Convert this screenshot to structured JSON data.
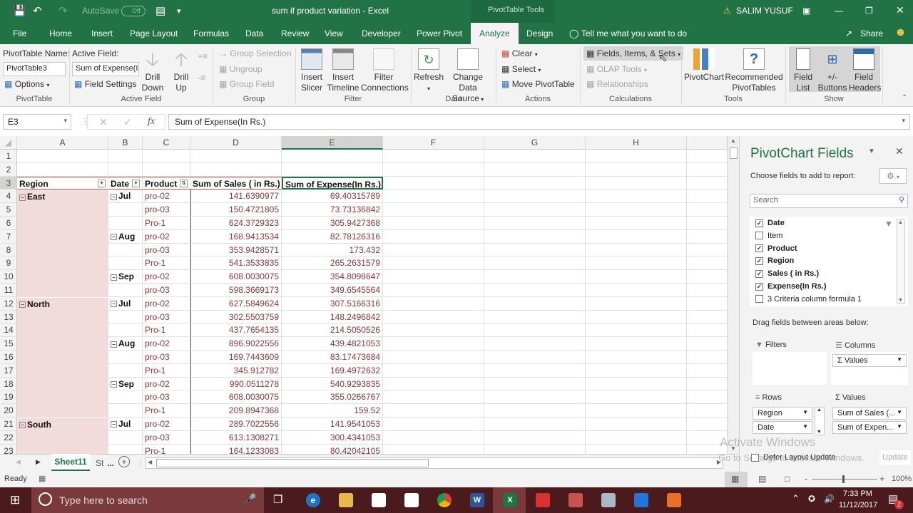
{
  "titlebar": {
    "autosave_label": "AutoSave",
    "autosave_state": "Off",
    "doc_title": "sum if product variation  -  Excel",
    "context_tab": "PivotTable Tools",
    "user": "SALIM YUSUF"
  },
  "tabs": {
    "items": [
      "File",
      "Home",
      "Insert",
      "Page Layout",
      "Formulas",
      "Data",
      "Review",
      "View",
      "Developer",
      "Power Pivot",
      "Analyze",
      "Design"
    ],
    "active": "Analyze",
    "tell_me": "Tell me what you want to do",
    "share": "Share"
  },
  "ribbon": {
    "pivottable": {
      "name_label": "PivotTable Name:",
      "name_value": "PivotTable3",
      "options": "Options",
      "group": "PivotTable"
    },
    "active_field": {
      "label": "Active Field:",
      "value": "Sum of Expense(In Rs.)",
      "field_settings": "Field Settings",
      "drill_down_1": "Drill",
      "drill_down_2": "Down",
      "drill_up_1": "Drill",
      "drill_up_2": "Up",
      "group": "Active Field"
    },
    "group": {
      "group_selection": "Group Selection",
      "ungroup": "Ungroup",
      "group_field": "Group Field",
      "group": "Group"
    },
    "filter": {
      "insert_slicer_1": "Insert",
      "insert_slicer_2": "Slicer",
      "insert_timeline_1": "Insert",
      "insert_timeline_2": "Timeline",
      "filter_conn_1": "Filter",
      "filter_conn_2": "Connections",
      "group": "Filter"
    },
    "data": {
      "refresh": "Refresh",
      "change_1": "Change Data",
      "change_2": "Source",
      "group": "Data"
    },
    "actions": {
      "clear": "Clear",
      "select": "Select",
      "move": "Move PivotTable",
      "group": "Actions"
    },
    "calculations": {
      "fields_items_sets": "Fields, Items, & Sets",
      "olap": "OLAP Tools",
      "relationships": "Relationships",
      "group": "Calculations"
    },
    "tools": {
      "pivotchart": "PivotChart",
      "recommended_1": "Recommended",
      "recommended_2": "PivotTables",
      "group": "Tools"
    },
    "show": {
      "field_list_1": "Field",
      "field_list_2": "List",
      "buttons_1": "+/-",
      "buttons_2": "Buttons",
      "headers_1": "Field",
      "headers_2": "Headers",
      "group": "Show"
    }
  },
  "formula_bar": {
    "name_box": "E3",
    "formula": "Sum of Expense(In Rs.)"
  },
  "grid": {
    "columns": [
      "A",
      "B",
      "C",
      "D",
      "E",
      "F",
      "G",
      "H"
    ],
    "selected_column": "E",
    "row_numbers": [
      "1",
      "2",
      "3",
      "4",
      "5",
      "6",
      "7",
      "8",
      "9",
      "10",
      "11",
      "12",
      "13",
      "14",
      "15",
      "16",
      "17",
      "18",
      "19",
      "20",
      "21",
      "22",
      "23"
    ],
    "headers": [
      "Region",
      "Date",
      "Product",
      "Sum of Sales ( in Rs.)",
      "Sum of Expense(In Rs.)"
    ],
    "rows": [
      {
        "region": "East",
        "date": "Jul",
        "product": "pro-02",
        "sales": "141.6390977",
        "expense": "69.40315789"
      },
      {
        "region": "",
        "date": "",
        "product": "pro-03",
        "sales": "150.4721805",
        "expense": "73.73136842"
      },
      {
        "region": "",
        "date": "",
        "product": "Pro-1",
        "sales": "624.3729323",
        "expense": "305.9427368"
      },
      {
        "region": "",
        "date": "Aug",
        "product": "pro-02",
        "sales": "168.9413534",
        "expense": "82.78126316"
      },
      {
        "region": "",
        "date": "",
        "product": "pro-03",
        "sales": "353.9428571",
        "expense": "173.432"
      },
      {
        "region": "",
        "date": "",
        "product": "Pro-1",
        "sales": "541.3533835",
        "expense": "265.2631579"
      },
      {
        "region": "",
        "date": "Sep",
        "product": "pro-02",
        "sales": "608.0030075",
        "expense": "354.8098647"
      },
      {
        "region": "",
        "date": "",
        "product": "pro-03",
        "sales": "598.3669173",
        "expense": "349.6545564"
      },
      {
        "region": "North",
        "date": "Jul",
        "product": "pro-02",
        "sales": "627.5849624",
        "expense": "307.5166316"
      },
      {
        "region": "",
        "date": "",
        "product": "pro-03",
        "sales": "302.5503759",
        "expense": "148.2496842"
      },
      {
        "region": "",
        "date": "",
        "product": "Pro-1",
        "sales": "437.7654135",
        "expense": "214.5050526"
      },
      {
        "region": "",
        "date": "Aug",
        "product": "pro-02",
        "sales": "896.9022556",
        "expense": "439.4821053"
      },
      {
        "region": "",
        "date": "",
        "product": "pro-03",
        "sales": "169.7443609",
        "expense": "83.17473684"
      },
      {
        "region": "",
        "date": "",
        "product": "Pro-1",
        "sales": "345.912782",
        "expense": "169.4972632"
      },
      {
        "region": "",
        "date": "Sep",
        "product": "pro-02",
        "sales": "990.0511278",
        "expense": "540.9293835"
      },
      {
        "region": "",
        "date": "",
        "product": "pro-03",
        "sales": "608.0030075",
        "expense": "355.0266767"
      },
      {
        "region": "",
        "date": "",
        "product": "Pro-1",
        "sales": "209.8947368",
        "expense": "159.52"
      },
      {
        "region": "South",
        "date": "Jul",
        "product": "pro-02",
        "sales": "289.7022556",
        "expense": "141.9541053"
      },
      {
        "region": "",
        "date": "",
        "product": "pro-03",
        "sales": "613.1308271",
        "expense": "300.4341053"
      },
      {
        "region": "",
        "date": "",
        "product": "Pro-1",
        "sales": "164.1233083",
        "expense": "80.42042105"
      }
    ]
  },
  "sheets": {
    "active": "Sheet11",
    "other": "St",
    "more": "..."
  },
  "status": {
    "ready": "Ready",
    "zoom": "100%"
  },
  "pane": {
    "title": "PivotChart Fields",
    "choose": "Choose fields to add to report:",
    "search_placeholder": "Search",
    "fields": [
      {
        "name": "Date",
        "checked": true,
        "bold": true
      },
      {
        "name": "Item",
        "checked": false,
        "bold": false
      },
      {
        "name": "Product",
        "checked": true,
        "bold": true
      },
      {
        "name": "Region",
        "checked": true,
        "bold": true
      },
      {
        "name": "Sales ( in Rs.)",
        "checked": true,
        "bold": true
      },
      {
        "name": "Expense(In Rs.)",
        "checked": true,
        "bold": true
      },
      {
        "name": "3 Criteria column  formula 1",
        "checked": false,
        "bold": false
      }
    ],
    "drag_label": "Drag fields between areas below:",
    "filters_label": "Filters",
    "columns_label": "Columns",
    "columns_items": [
      "Values"
    ],
    "rows_label": "Rows",
    "rows_items": [
      "Region",
      "Date"
    ],
    "values_label": "Values",
    "values_items": [
      "Sum of Sales (...",
      "Sum of Expen..."
    ],
    "defer": "Defer Layout Update",
    "update": "Update",
    "watermark_1": "Activate Windows",
    "watermark_2": "Go to Settings to activate Windows."
  },
  "taskbar": {
    "search_placeholder": "Type here to search",
    "time": "7:33 PM",
    "date": "11/12/2017",
    "notifications": "2"
  }
}
